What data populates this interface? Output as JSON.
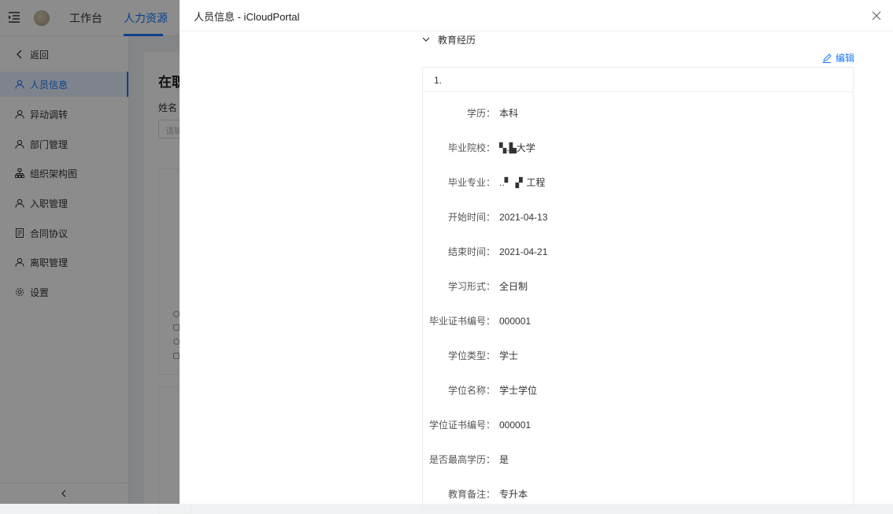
{
  "topbar": {
    "tabs": [
      {
        "label": "工作台",
        "active": false
      },
      {
        "label": "人力资源",
        "active": true
      }
    ]
  },
  "sidebar": {
    "items": [
      {
        "label": "返回",
        "icon": "chevron-left-icon",
        "active": false
      },
      {
        "label": "人员信息",
        "icon": "user-icon",
        "active": true
      },
      {
        "label": "异动调转",
        "icon": "user-icon",
        "active": false
      },
      {
        "label": "部门管理",
        "icon": "user-icon",
        "active": false
      },
      {
        "label": "组织架构图",
        "icon": "org-chart-icon",
        "active": false
      },
      {
        "label": "入职管理",
        "icon": "user-icon",
        "active": false
      },
      {
        "label": "合同协议",
        "icon": "contract-icon",
        "active": false
      },
      {
        "label": "离职管理",
        "icon": "user-icon",
        "active": false
      },
      {
        "label": "设置",
        "icon": "gear-icon",
        "active": false
      }
    ]
  },
  "background_page": {
    "title": "在职",
    "name_label": "姓名",
    "name_placeholder": "请输"
  },
  "drawer": {
    "title": "人员信息 - iCloudPortal",
    "section_title": "教育经历",
    "edit_label": "编辑",
    "record_index": "1.",
    "fields": [
      {
        "label": "学历：",
        "value": "本科"
      },
      {
        "label": "毕业院校：",
        "value": "▚.▙大学"
      },
      {
        "label": "毕业专业：",
        "value": "..▘▗▘工程"
      },
      {
        "label": "开始时间：",
        "value": "2021-04-13"
      },
      {
        "label": "结束时间：",
        "value": "2021-04-21"
      },
      {
        "label": "学习形式：",
        "value": "全日制"
      },
      {
        "label": "毕业证书编号：",
        "value": "000001"
      },
      {
        "label": "学位类型：",
        "value": "学士"
      },
      {
        "label": "学位名称：",
        "value": "学士学位"
      },
      {
        "label": "学位证书编号：",
        "value": "000001"
      },
      {
        "label": "是否最高学历：",
        "value": "是"
      },
      {
        "label": "教育备注：",
        "value": "专升本"
      }
    ]
  },
  "colors": {
    "accent": "#1677ff",
    "overlay": "rgba(0,0,0,0.45)"
  }
}
